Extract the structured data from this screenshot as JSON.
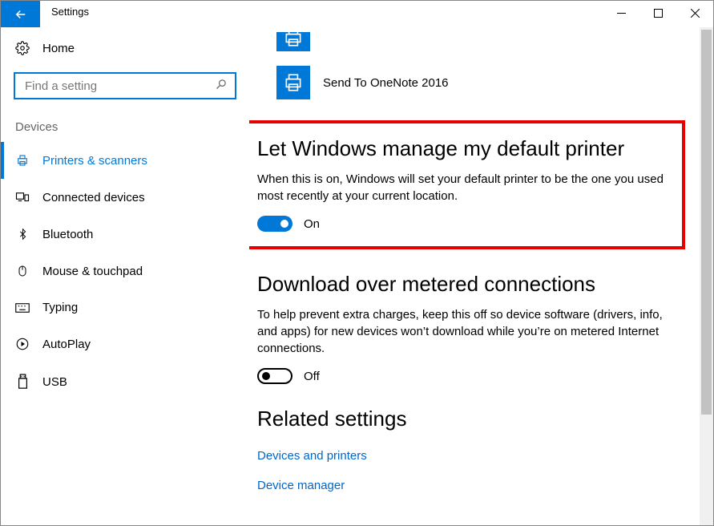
{
  "window": {
    "title": "Settings"
  },
  "sidebar": {
    "home_label": "Home",
    "search_placeholder": "Find a setting",
    "category": "Devices",
    "items": [
      {
        "label": "Printers & scanners",
        "icon": "printer"
      },
      {
        "label": "Connected devices",
        "icon": "devices"
      },
      {
        "label": "Bluetooth",
        "icon": "bluetooth"
      },
      {
        "label": "Mouse & touchpad",
        "icon": "mouse"
      },
      {
        "label": "Typing",
        "icon": "keyboard"
      },
      {
        "label": "AutoPlay",
        "icon": "autoplay"
      },
      {
        "label": "USB",
        "icon": "usb"
      }
    ]
  },
  "main": {
    "printer_item_label": "Send To OneNote 2016",
    "default_printer": {
      "heading": "Let Windows manage my default printer",
      "description": "When this is on, Windows will set your default printer to be the one you used most recently at your current location.",
      "state_label": "On"
    },
    "metered": {
      "heading": "Download over metered connections",
      "description": "To help prevent extra charges, keep this off so device software (drivers, info, and apps) for new devices won’t download while you’re on metered Internet connections.",
      "state_label": "Off"
    },
    "related": {
      "heading": "Related settings",
      "links": [
        "Devices and printers",
        "Device manager"
      ]
    }
  }
}
